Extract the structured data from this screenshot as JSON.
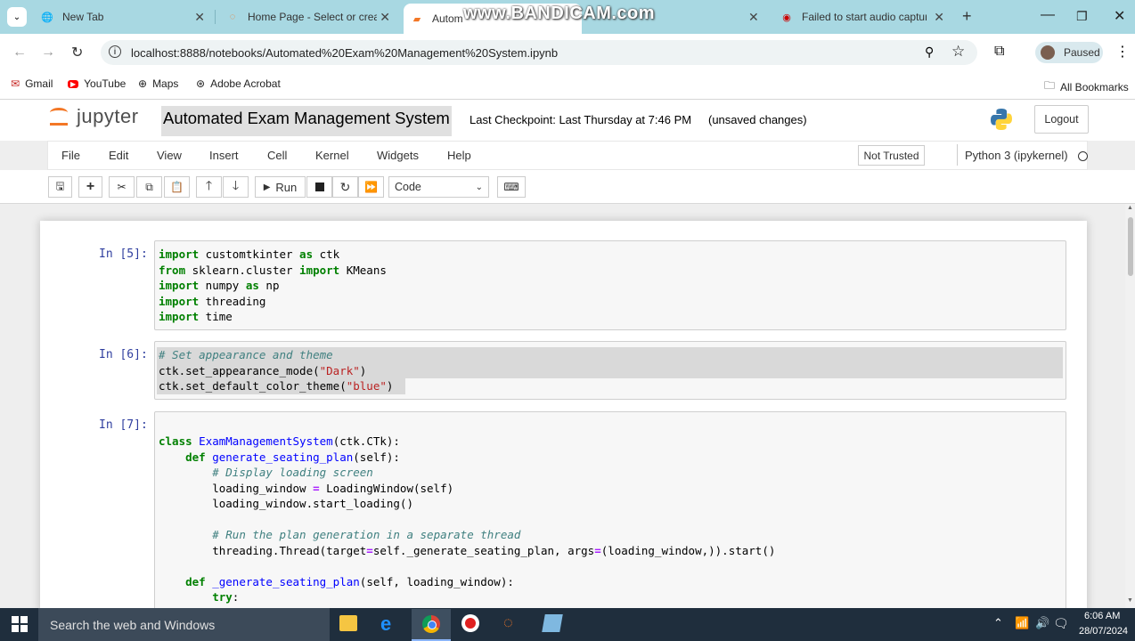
{
  "browser": {
    "tabs": [
      {
        "label": "New Tab",
        "icon": "globe-icon"
      },
      {
        "label": "Home Page - Select or creat",
        "icon": "jupyter-icon"
      },
      {
        "label": "Automated Exam Management",
        "icon": "notebook-icon",
        "active": true
      },
      {
        "label": "Failed to start audio capture",
        "icon": "record-icon"
      }
    ],
    "watermark": "www.BANDICAM.com",
    "url": "localhost:8888/notebooks/Automated%20Exam%20Management%20System.ipynb",
    "profile_label": "Paused",
    "bookmarks": [
      {
        "label": "Gmail",
        "icon": "gmail-icon"
      },
      {
        "label": "YouTube",
        "icon": "youtube-icon"
      },
      {
        "label": "Maps",
        "icon": "maps-icon"
      },
      {
        "label": "Adobe Acrobat",
        "icon": "acrobat-icon"
      }
    ],
    "all_bookmarks": "All Bookmarks"
  },
  "jupyter": {
    "logo_text": "jupyter",
    "notebook_title": "Automated Exam Management System",
    "checkpoint": "Last Checkpoint: Last Thursday at 7:46 PM",
    "unsaved": "(unsaved changes)",
    "logout": "Logout",
    "menu": [
      "File",
      "Edit",
      "View",
      "Insert",
      "Cell",
      "Kernel",
      "Widgets",
      "Help"
    ],
    "trust": "Not Trusted",
    "kernel": "Python 3 (ipykernel)",
    "run_label": "Run",
    "cell_type": "Code"
  },
  "cells": [
    {
      "prompt": "In [5]:"
    },
    {
      "prompt": "In [6]:"
    },
    {
      "prompt": "In [7]:"
    }
  ],
  "taskbar": {
    "search_placeholder": "Search the web and Windows",
    "time": "6:06 AM",
    "date": "28/07/2024"
  },
  "colors": {
    "tabstrip": "#a8d8e2",
    "prompt": "#303f9f",
    "keyword": "#008000",
    "string": "#ba2121",
    "comment": "#408080",
    "taskbar": "#1f2e3d"
  }
}
